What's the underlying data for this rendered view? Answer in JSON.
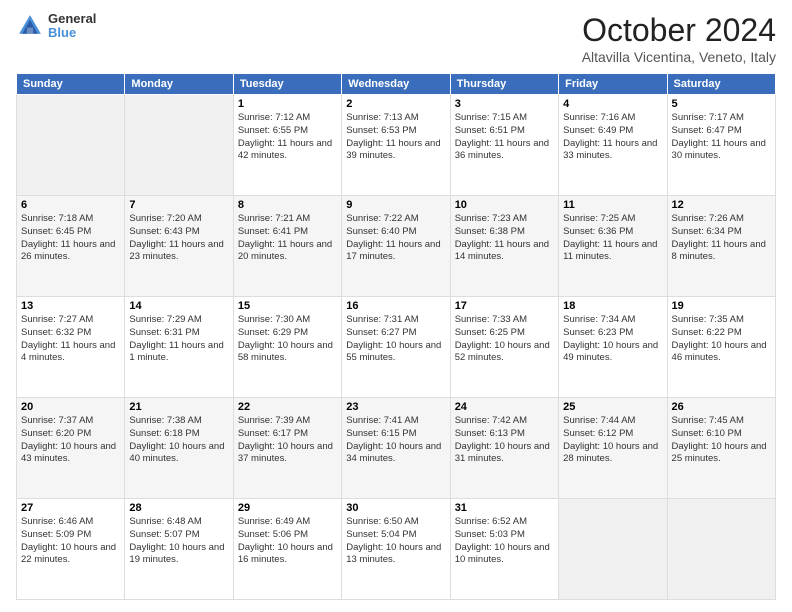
{
  "header": {
    "logo": {
      "line1": "General",
      "line2": "Blue"
    },
    "title": "October 2024",
    "location": "Altavilla Vicentina, Veneto, Italy"
  },
  "weekdays": [
    "Sunday",
    "Monday",
    "Tuesday",
    "Wednesday",
    "Thursday",
    "Friday",
    "Saturday"
  ],
  "weeks": [
    [
      {
        "day": "",
        "info": ""
      },
      {
        "day": "",
        "info": ""
      },
      {
        "day": "1",
        "info": "Sunrise: 7:12 AM\nSunset: 6:55 PM\nDaylight: 11 hours and 42 minutes."
      },
      {
        "day": "2",
        "info": "Sunrise: 7:13 AM\nSunset: 6:53 PM\nDaylight: 11 hours and 39 minutes."
      },
      {
        "day": "3",
        "info": "Sunrise: 7:15 AM\nSunset: 6:51 PM\nDaylight: 11 hours and 36 minutes."
      },
      {
        "day": "4",
        "info": "Sunrise: 7:16 AM\nSunset: 6:49 PM\nDaylight: 11 hours and 33 minutes."
      },
      {
        "day": "5",
        "info": "Sunrise: 7:17 AM\nSunset: 6:47 PM\nDaylight: 11 hours and 30 minutes."
      }
    ],
    [
      {
        "day": "6",
        "info": "Sunrise: 7:18 AM\nSunset: 6:45 PM\nDaylight: 11 hours and 26 minutes."
      },
      {
        "day": "7",
        "info": "Sunrise: 7:20 AM\nSunset: 6:43 PM\nDaylight: 11 hours and 23 minutes."
      },
      {
        "day": "8",
        "info": "Sunrise: 7:21 AM\nSunset: 6:41 PM\nDaylight: 11 hours and 20 minutes."
      },
      {
        "day": "9",
        "info": "Sunrise: 7:22 AM\nSunset: 6:40 PM\nDaylight: 11 hours and 17 minutes."
      },
      {
        "day": "10",
        "info": "Sunrise: 7:23 AM\nSunset: 6:38 PM\nDaylight: 11 hours and 14 minutes."
      },
      {
        "day": "11",
        "info": "Sunrise: 7:25 AM\nSunset: 6:36 PM\nDaylight: 11 hours and 11 minutes."
      },
      {
        "day": "12",
        "info": "Sunrise: 7:26 AM\nSunset: 6:34 PM\nDaylight: 11 hours and 8 minutes."
      }
    ],
    [
      {
        "day": "13",
        "info": "Sunrise: 7:27 AM\nSunset: 6:32 PM\nDaylight: 11 hours and 4 minutes."
      },
      {
        "day": "14",
        "info": "Sunrise: 7:29 AM\nSunset: 6:31 PM\nDaylight: 11 hours and 1 minute."
      },
      {
        "day": "15",
        "info": "Sunrise: 7:30 AM\nSunset: 6:29 PM\nDaylight: 10 hours and 58 minutes."
      },
      {
        "day": "16",
        "info": "Sunrise: 7:31 AM\nSunset: 6:27 PM\nDaylight: 10 hours and 55 minutes."
      },
      {
        "day": "17",
        "info": "Sunrise: 7:33 AM\nSunset: 6:25 PM\nDaylight: 10 hours and 52 minutes."
      },
      {
        "day": "18",
        "info": "Sunrise: 7:34 AM\nSunset: 6:23 PM\nDaylight: 10 hours and 49 minutes."
      },
      {
        "day": "19",
        "info": "Sunrise: 7:35 AM\nSunset: 6:22 PM\nDaylight: 10 hours and 46 minutes."
      }
    ],
    [
      {
        "day": "20",
        "info": "Sunrise: 7:37 AM\nSunset: 6:20 PM\nDaylight: 10 hours and 43 minutes."
      },
      {
        "day": "21",
        "info": "Sunrise: 7:38 AM\nSunset: 6:18 PM\nDaylight: 10 hours and 40 minutes."
      },
      {
        "day": "22",
        "info": "Sunrise: 7:39 AM\nSunset: 6:17 PM\nDaylight: 10 hours and 37 minutes."
      },
      {
        "day": "23",
        "info": "Sunrise: 7:41 AM\nSunset: 6:15 PM\nDaylight: 10 hours and 34 minutes."
      },
      {
        "day": "24",
        "info": "Sunrise: 7:42 AM\nSunset: 6:13 PM\nDaylight: 10 hours and 31 minutes."
      },
      {
        "day": "25",
        "info": "Sunrise: 7:44 AM\nSunset: 6:12 PM\nDaylight: 10 hours and 28 minutes."
      },
      {
        "day": "26",
        "info": "Sunrise: 7:45 AM\nSunset: 6:10 PM\nDaylight: 10 hours and 25 minutes."
      }
    ],
    [
      {
        "day": "27",
        "info": "Sunrise: 6:46 AM\nSunset: 5:09 PM\nDaylight: 10 hours and 22 minutes."
      },
      {
        "day": "28",
        "info": "Sunrise: 6:48 AM\nSunset: 5:07 PM\nDaylight: 10 hours and 19 minutes."
      },
      {
        "day": "29",
        "info": "Sunrise: 6:49 AM\nSunset: 5:06 PM\nDaylight: 10 hours and 16 minutes."
      },
      {
        "day": "30",
        "info": "Sunrise: 6:50 AM\nSunset: 5:04 PM\nDaylight: 10 hours and 13 minutes."
      },
      {
        "day": "31",
        "info": "Sunrise: 6:52 AM\nSunset: 5:03 PM\nDaylight: 10 hours and 10 minutes."
      },
      {
        "day": "",
        "info": ""
      },
      {
        "day": "",
        "info": ""
      }
    ]
  ]
}
